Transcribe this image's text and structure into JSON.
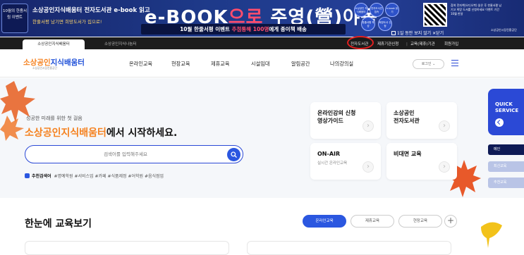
{
  "banner": {
    "badge": "10월의 한줌서림 이벤트",
    "line1": "소상공인지식배움터 전자도서관 e-book 읽고",
    "line2": "한줄서평 남기면 희망도서가 집으로!",
    "big_prefix": "e-BOOK",
    "big_accent": "으로",
    "big_rest": " 주영(營)야독",
    "sub_pre": "10월 한줄서평 이벤트 ",
    "sub_hl": "추첨통해 100명",
    "sub_post": "에게 종이책 배송",
    "circles": [
      "소상공인 지식배움터",
      "전자도서관 접속",
      "e-book 읽기",
      "한줄서평 작성",
      "희망도서 신청"
    ],
    "right_text": "참여 전자책(오디오북) 읽은 후 한줄서평 남기고 희망 도서를 신청하세요 이벤트 기간 10월 한달",
    "close_label": "1일 동안 보지 않기",
    "close_x": "✕",
    "close_word": "닫기",
    "logo_text": "소상공인시장진흥공단"
  },
  "topbar": {
    "tab_main": "소상공인지식배움터",
    "tab_sub": "소상공인지식나눔터",
    "util": [
      "전자도서관",
      "제휴기관신청",
      "교육(제휴)기관",
      "회원가입"
    ]
  },
  "nav": {
    "logo_main": "소상공인",
    "logo_main2": "지식배움터",
    "logo_sub": "소상공인시장진흥공단",
    "items": [
      "온라인교육",
      "현장교육",
      "제휴교육",
      "시설임대",
      "알림공간",
      "나의강의실"
    ],
    "login": "로그인 ⌄"
  },
  "hero": {
    "small": "성공한 미래를 위한 첫 걸음",
    "title_hl": "소상공인지식배움터",
    "title_rest": "에서 시작하세요.",
    "search_placeholder": "검색어를 입력해주세요",
    "reco_label": "추천검색어",
    "reco_tags": "#명예학원  #서비스업  #카페  #식품제정  #어학원  #음식점업"
  },
  "cards": [
    {
      "title": "온라인강의 신청\n영상가이드",
      "sub": ""
    },
    {
      "title": "소상공인\n전자도서관",
      "sub": ""
    },
    {
      "title": "ON-AIR",
      "sub": "실시간 온라인교육"
    },
    {
      "title": "비대면 교육",
      "sub": ""
    }
  ],
  "quick": {
    "title1": "QUICK",
    "title2": "SERVICE",
    "btn1": "메인",
    "btn2": "최신교육",
    "btn3": "추천교육"
  },
  "section": {
    "title": "한눈에 교육보기",
    "filters": [
      "온라인교육",
      "제휴교육",
      "현장교육"
    ],
    "plus": "+"
  },
  "colors": {
    "brand_blue": "#2b49d6",
    "brand_orange": "#f58220",
    "banner_bg": "#1e3a8a"
  }
}
